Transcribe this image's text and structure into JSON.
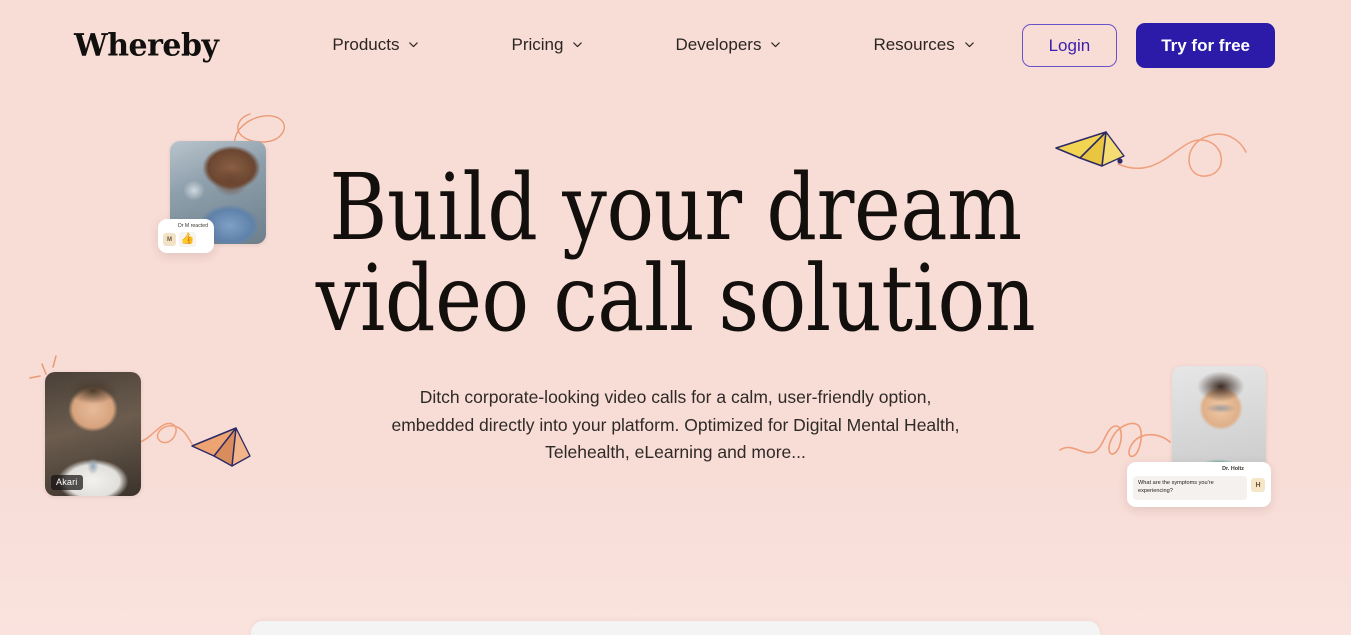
{
  "theme": {
    "background": "#f8dcd6",
    "primary_button": "#2b1ba8",
    "login_border": "#6a53c9",
    "login_text": "#3b1fae",
    "heading_color": "#120f0d",
    "doodle_color": "#e8916a"
  },
  "header": {
    "logo": "Whereby",
    "nav": [
      {
        "label": "Products",
        "icon": "chevron-down-icon"
      },
      {
        "label": "Pricing",
        "icon": "chevron-down-icon"
      },
      {
        "label": "Developers",
        "icon": "chevron-down-icon"
      },
      {
        "label": "Resources",
        "icon": "chevron-down-icon"
      }
    ],
    "login_label": "Login",
    "try_label": "Try for free"
  },
  "hero": {
    "title_line1": "Build your dream",
    "title_line2": "video call solution",
    "subtitle": "Ditch corporate-looking video calls for a calm, user-friendly option, embedded directly into your platform. Optimized for Digital Mental Health, Telehealth, eLearning and more..."
  },
  "tiles": {
    "top_left": {
      "name": "",
      "alt": "male-doctor-video-tile"
    },
    "bottom_left": {
      "name": "Akari",
      "alt": "smiling-doctor-video-tile"
    },
    "right": {
      "name": "",
      "alt": "female-doctor-video-tile"
    }
  },
  "cards": {
    "reaction": {
      "label": "Dr M reacted",
      "avatar_initial": "M",
      "emoji": "👍"
    },
    "chat": {
      "name": "Dr. Holtz",
      "message": "What are the symptoms you're experiencing?",
      "avatar_initial": "H"
    }
  }
}
